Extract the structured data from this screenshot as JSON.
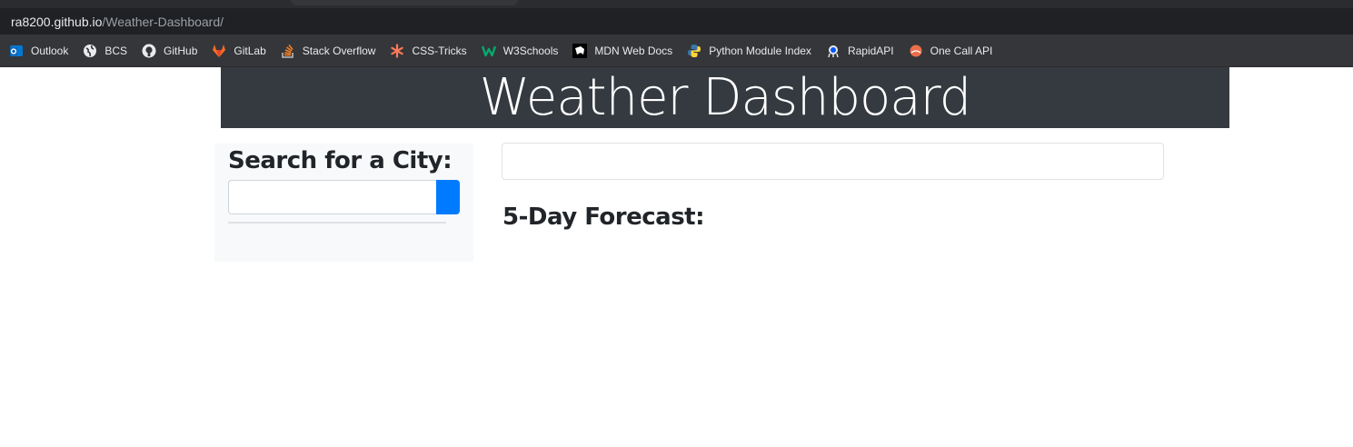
{
  "browser": {
    "url_host": "ra8200.github.io",
    "url_path": "/Weather-Dashboard/",
    "bookmarks": [
      {
        "label": "Outlook",
        "icon": "outlook-icon",
        "color": "#0078d4"
      },
      {
        "label": "BCS",
        "icon": "globe-icon",
        "color": "#e8eaed"
      },
      {
        "label": "GitHub",
        "icon": "github-icon",
        "color": "#e8eaed"
      },
      {
        "label": "GitLab",
        "icon": "gitlab-icon",
        "color": "#fc6d26"
      },
      {
        "label": "Stack Overflow",
        "icon": "stackoverflow-icon",
        "color": "#f48024"
      },
      {
        "label": "CSS-Tricks",
        "icon": "css-tricks-icon",
        "color": "#ff7a59"
      },
      {
        "label": "W3Schools",
        "icon": "w3schools-icon",
        "color": "#04aa6d"
      },
      {
        "label": "MDN Web Docs",
        "icon": "mdn-icon",
        "color": "#ffffff"
      },
      {
        "label": "Python Module Index",
        "icon": "python-icon",
        "color": "#3776ab"
      },
      {
        "label": "RapidAPI",
        "icon": "rapidapi-icon",
        "color": "#0055ff"
      },
      {
        "label": "One Call API",
        "icon": "openweather-icon",
        "color": "#eb6e4b"
      }
    ]
  },
  "page": {
    "title": "Weather Dashboard",
    "search_heading": "Search for a City:",
    "search_value": "",
    "forecast_heading": "5-Day Forecast:"
  },
  "colors": {
    "header_bg": "#343a40",
    "sidebar_bg": "#f8f9fa",
    "search_button": "#007bff"
  }
}
